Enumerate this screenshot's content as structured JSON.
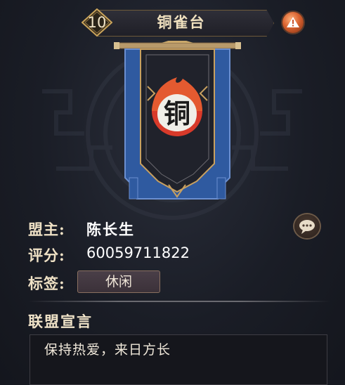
{
  "header": {
    "level": "10",
    "guild_name": "铜雀台"
  },
  "banner": {
    "emblem_char": "铜"
  },
  "info": {
    "leader_label": "盟主:",
    "leader_name": "陈长生",
    "score_label": "评分:",
    "score_value": "60059711822",
    "tag_label": "标签:",
    "tag_value": "休闲"
  },
  "declaration": {
    "title": "联盟宣言",
    "text": "保持热爱，来日方长"
  },
  "icons": {
    "warning": "warning-icon",
    "chat": "chat-bubble-icon"
  },
  "colors": {
    "banner_blue": "#2f5aa0",
    "banner_gold": "#c8a060",
    "emblem_red": "#d83a2a"
  }
}
